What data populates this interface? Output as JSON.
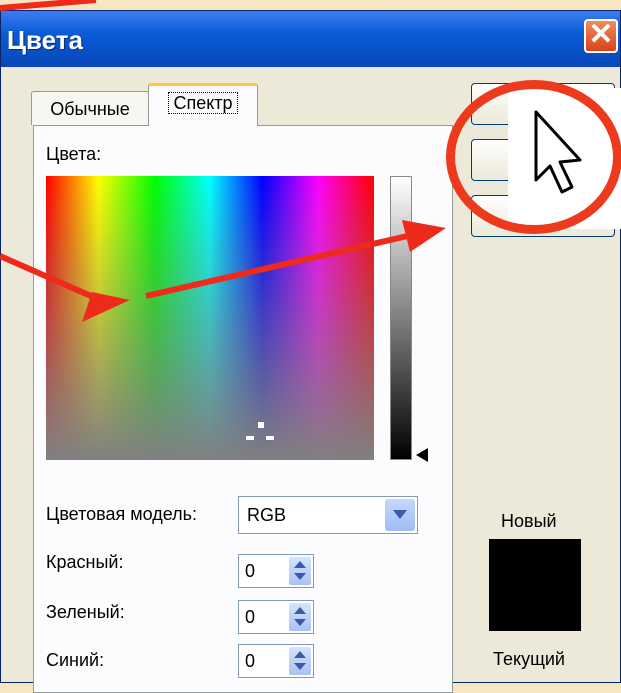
{
  "dialog": {
    "title": "Цвета",
    "close_glyph": "✕"
  },
  "tabs": [
    {
      "label": "Обычные",
      "active": false
    },
    {
      "label": "Спектр",
      "active": true
    }
  ],
  "spectrum": {
    "colors_label": "Цвета:",
    "luminance_marker_icon": "triangle-left"
  },
  "form": {
    "model_label": "Цветовая модель:",
    "model_value": "RGB",
    "red_label": "Красный:",
    "red_value": "0",
    "green_label": "Зеленый:",
    "green_value": "0",
    "blue_label": "Синий:",
    "blue_value": "0"
  },
  "preview": {
    "new_label": "Новый",
    "current_label": "Текущий",
    "color": "#000000"
  },
  "annotation": {
    "arrow_color": "#ee2a1b",
    "circle_color": "#ee3a1c",
    "cursor_icon": "mouse-pointer-icon"
  }
}
